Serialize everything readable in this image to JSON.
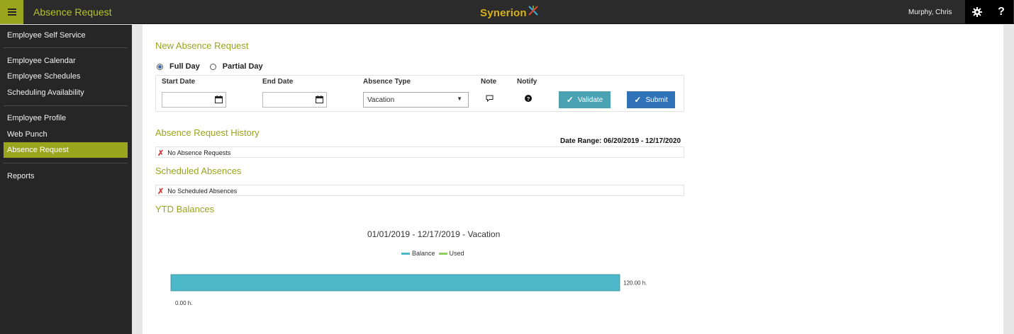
{
  "header": {
    "app_title": "Absence Request",
    "logo_text": "Synerion",
    "user_name": "Murphy, Chris",
    "help_label": "?"
  },
  "sidebar": {
    "items": [
      {
        "label": "Employee Self Service"
      },
      {
        "label": "Employee Calendar"
      },
      {
        "label": "Employee Schedules"
      },
      {
        "label": "Scheduling Availability"
      },
      {
        "label": "Employee Profile"
      },
      {
        "label": "Web Punch"
      },
      {
        "label": "Absence Request",
        "active": true
      },
      {
        "label": "Reports"
      }
    ]
  },
  "new_request": {
    "title": "New Absence Request",
    "options": [
      {
        "label": "Full Day",
        "selected": true
      },
      {
        "label": "Partial Day",
        "selected": false
      }
    ],
    "columns": {
      "start_date": "Start Date",
      "end_date": "End Date",
      "absence_type": "Absence Type",
      "note": "Note",
      "notify": "Notify"
    },
    "start_date_value": "",
    "end_date_value": "",
    "absence_type_value": "Vacation",
    "validate_label": "Validate",
    "submit_label": "Submit"
  },
  "history": {
    "title": "Absence Request History",
    "date_range": "Date Range: 06/20/2019 - 12/17/2020",
    "empty_text": "No Absence Requests"
  },
  "scheduled": {
    "title": "Scheduled Absences",
    "empty_text": "No Scheduled Absences"
  },
  "ytd": {
    "title": "YTD Balances"
  },
  "colors": {
    "accent": "#9aa41c",
    "balance": "#4db8c9",
    "used": "#8fcf5f",
    "validate": "#4aa2b3",
    "submit": "#2f72b8"
  },
  "chart_data": {
    "type": "bar",
    "orientation": "horizontal",
    "title": "01/01/2019 - 12/17/2019 - Vacation",
    "legend": [
      "Balance",
      "Used"
    ],
    "legend_position": "top-center",
    "series": [
      {
        "name": "Balance",
        "values": [
          120.0
        ],
        "label": "120.00 h."
      },
      {
        "name": "Used",
        "values": [
          0.0
        ],
        "label": "0.00 h."
      }
    ],
    "xlim": [
      0,
      120
    ]
  }
}
